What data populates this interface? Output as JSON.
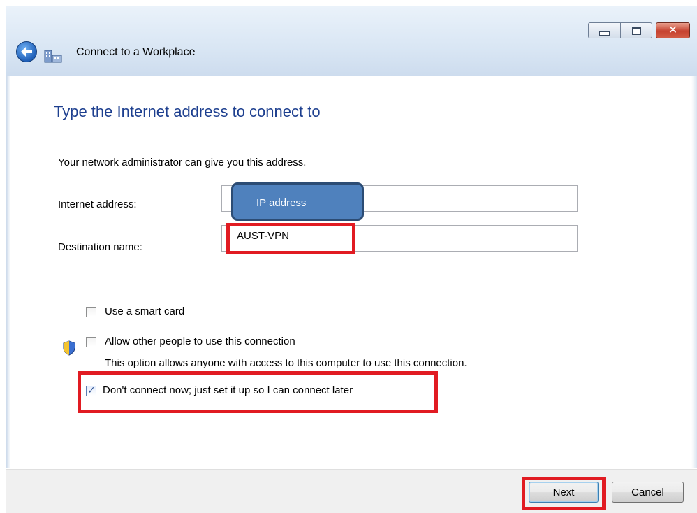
{
  "window": {
    "title": "Connect to a Workplace"
  },
  "main": {
    "heading": "Type the Internet address to connect to",
    "subtext": "Your network administrator can give you this address.",
    "internet_address_label": "Internet address:",
    "internet_address_callout": "IP address",
    "destination_name_label": "Destination name:",
    "destination_name_value": "AUST-VPN"
  },
  "options": {
    "smart_card": {
      "label": "Use a smart card",
      "checked": false
    },
    "allow_others": {
      "label": "Allow other people to use this connection",
      "description": "This option allows anyone with access to this computer to use this connection.",
      "checked": false
    },
    "dont_connect": {
      "label": "Don't connect now; just set it up so I can connect later",
      "checked": true
    }
  },
  "footer": {
    "next_label": "Next",
    "cancel_label": "Cancel"
  },
  "colors": {
    "heading": "#1d3f8f",
    "highlight": "#e11b22",
    "callout": "#4f81bd"
  }
}
